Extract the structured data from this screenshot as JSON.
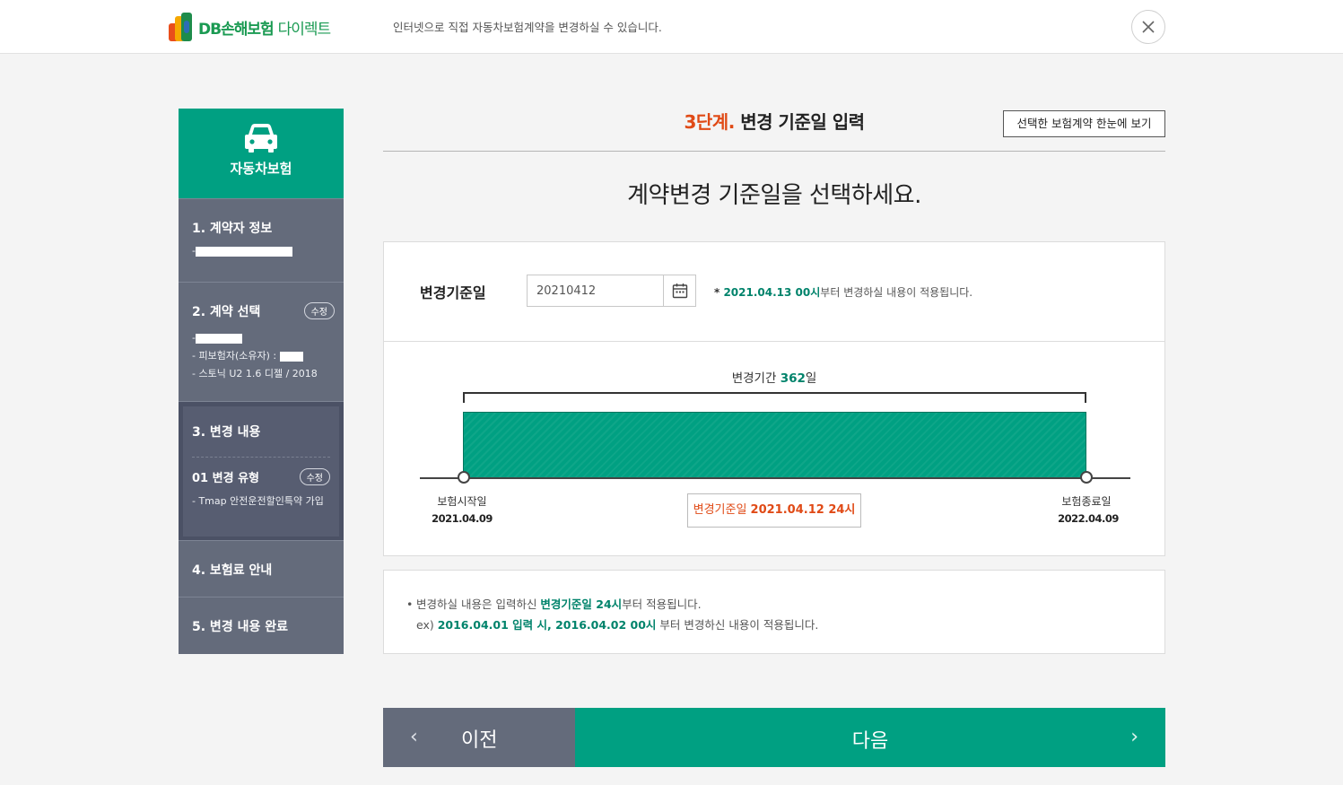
{
  "header": {
    "logo_brand": "DB손해보험",
    "logo_sub": "다이렉트",
    "description": "인터넷으로 직접 자동차보험계약을 변경하실 수 있습니다.",
    "close_label": "✕"
  },
  "sidebar": {
    "title": "자동차보험",
    "sections": [
      {
        "title": "1. 계약자 정보",
        "lines": [
          "-"
        ]
      },
      {
        "title": "2. 계약 선택",
        "badge": "수정",
        "lines": [
          "-",
          "- 피보험자(소유자) : ",
          "- 스토닉 U2 1.6 디젤 / 2018"
        ]
      },
      {
        "title": "3. 변경 내용",
        "sub_title": "01 변경 유형",
        "badge": "수정",
        "lines": [
          "- Tmap 안전운전할인특약 가입"
        ]
      },
      {
        "title": "4. 보험료 안내"
      },
      {
        "title": "5. 변경 내용 완료"
      }
    ]
  },
  "step": {
    "number": "3단계.",
    "title": "변경 기준일 입력",
    "view_all_button": "선택한 보험계약 한눈에 보기"
  },
  "main_heading": "계약변경 기준일을 선택하세요.",
  "date_form": {
    "label": "변경기준일",
    "value": "20210412",
    "note_prefix": "* ",
    "note_date": "2021.04.13 00시",
    "note_suffix": "부터 변경하실 내용이 적용됩니다."
  },
  "timeline": {
    "period_prefix": "변경기간 ",
    "period_days": "362",
    "period_suffix": "일",
    "start_label": "보험시작일",
    "start_date": "2021.04.09",
    "end_label": "보험종료일",
    "end_date": "2022.04.09",
    "base_label": "변경기준일 ",
    "base_value": "2021.04.12 24시"
  },
  "notice": {
    "bullet": "•",
    "line1_prefix": "변경하실 내용은 입력하신 ",
    "line1_highlight": "변경기준일 24시",
    "line1_suffix": "부터 적용됩니다.",
    "line2_prefix": "ex) ",
    "line2_highlight": "2016.04.01 입력 시, 2016.04.02 00시",
    "line2_suffix": " 부터 변경하신 내용이 적용됩니다."
  },
  "nav": {
    "prev_label": "이전",
    "next_label": "다음",
    "prev_arrow": "‹",
    "next_arrow": "›"
  },
  "colors": {
    "brand_green": "#00a082",
    "sidebar_gray": "#646b7b",
    "accent_orange": "#e04a16"
  }
}
